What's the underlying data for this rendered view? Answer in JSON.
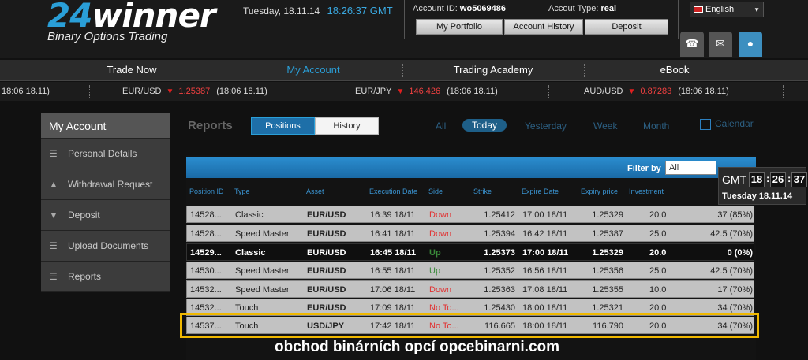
{
  "logo": {
    "number": "24",
    "word": "winner",
    "tagline": "Binary Options Trading"
  },
  "header": {
    "date": "Tuesday, 18.11.14",
    "time": "18:26:37",
    "tz": "GMT",
    "account_id_label": "Account ID:",
    "account_id": "wo5069486",
    "account_type_label": "Accout Type:",
    "account_type": "real",
    "buttons": [
      "My Portfolio",
      "Account History",
      "Deposit"
    ],
    "language": "English"
  },
  "nav": [
    "Trade Now",
    "My Account",
    "Trading Academy",
    "eBook"
  ],
  "ticker": [
    {
      "pair": "",
      "value": "",
      "time": "18:06 18.11)"
    },
    {
      "pair": "EUR/USD",
      "value": "1.25387",
      "time": "(18:06 18.11)"
    },
    {
      "pair": "EUR/JPY",
      "value": "146.426",
      "time": "(18:06 18.11)"
    },
    {
      "pair": "AUD/USD",
      "value": "0.87283",
      "time": "(18:06 18.11)"
    }
  ],
  "sidebar": {
    "title": "My Account",
    "items": [
      "Personal Details",
      "Withdrawal Request",
      "Deposit",
      "Upload Documents",
      "Reports"
    ]
  },
  "reports": {
    "title": "Reports",
    "tabs": [
      "Positions",
      "History"
    ],
    "periods": [
      "All",
      "Today",
      "Yesterday",
      "Week",
      "Month"
    ],
    "calendar": "Calendar",
    "filter_label": "Filter by",
    "filter_value": "All",
    "columns": [
      "Position ID",
      "Type",
      "Asset",
      "Execution Date",
      "Side",
      "Strike",
      "Expire Date",
      "Expiry price",
      "Investment"
    ],
    "rows": [
      {
        "id": "14528...",
        "type": "Classic",
        "asset": "EUR/USD",
        "exec": "16:39 18/11",
        "side": "Down",
        "strike": "1.25412",
        "expire": "17:00 18/11",
        "expiry_price": "1.25329",
        "investment": "20.0",
        "payout": "37 (85%)"
      },
      {
        "id": "14528...",
        "type": "Speed Master",
        "asset": "EUR/USD",
        "exec": "16:41 18/11",
        "side": "Down",
        "strike": "1.25394",
        "expire": "16:42 18/11",
        "expiry_price": "1.25387",
        "investment": "25.0",
        "payout": "42.5 (70%)"
      },
      {
        "id": "14529...",
        "type": "Classic",
        "asset": "EUR/USD",
        "exec": "16:45 18/11",
        "side": "Up",
        "strike": "1.25373",
        "expire": "17:00 18/11",
        "expiry_price": "1.25329",
        "investment": "20.0",
        "payout": "0 (0%)"
      },
      {
        "id": "14530...",
        "type": "Speed Master",
        "asset": "EUR/USD",
        "exec": "16:55 18/11",
        "side": "Up",
        "strike": "1.25352",
        "expire": "16:56 18/11",
        "expiry_price": "1.25356",
        "investment": "25.0",
        "payout": "42.5 (70%)"
      },
      {
        "id": "14532...",
        "type": "Speed Master",
        "asset": "EUR/USD",
        "exec": "17:06 18/11",
        "side": "Down",
        "strike": "1.25363",
        "expire": "17:08 18/11",
        "expiry_price": "1.25355",
        "investment": "10.0",
        "payout": "17 (70%)"
      },
      {
        "id": "14532...",
        "type": "Touch",
        "asset": "EUR/USD",
        "exec": "17:09 18/11",
        "side": "No To...",
        "strike": "1.25430",
        "expire": "18:00 18/11",
        "expiry_price": "1.25321",
        "investment": "20.0",
        "payout": "34 (70%)"
      },
      {
        "id": "14537...",
        "type": "Touch",
        "asset": "USD/JPY",
        "exec": "17:42 18/11",
        "side": "No To...",
        "strike": "116.665",
        "expire": "18:00 18/11",
        "expiry_price": "116.790",
        "investment": "20.0",
        "payout": "34 (70%)"
      }
    ]
  },
  "clock": {
    "label": "GMT",
    "h": "18",
    "m": "26",
    "s": "37",
    "date": "Tuesday  18.11.14"
  },
  "watermark": "obchod binárních opcí opcebinarni.com"
}
